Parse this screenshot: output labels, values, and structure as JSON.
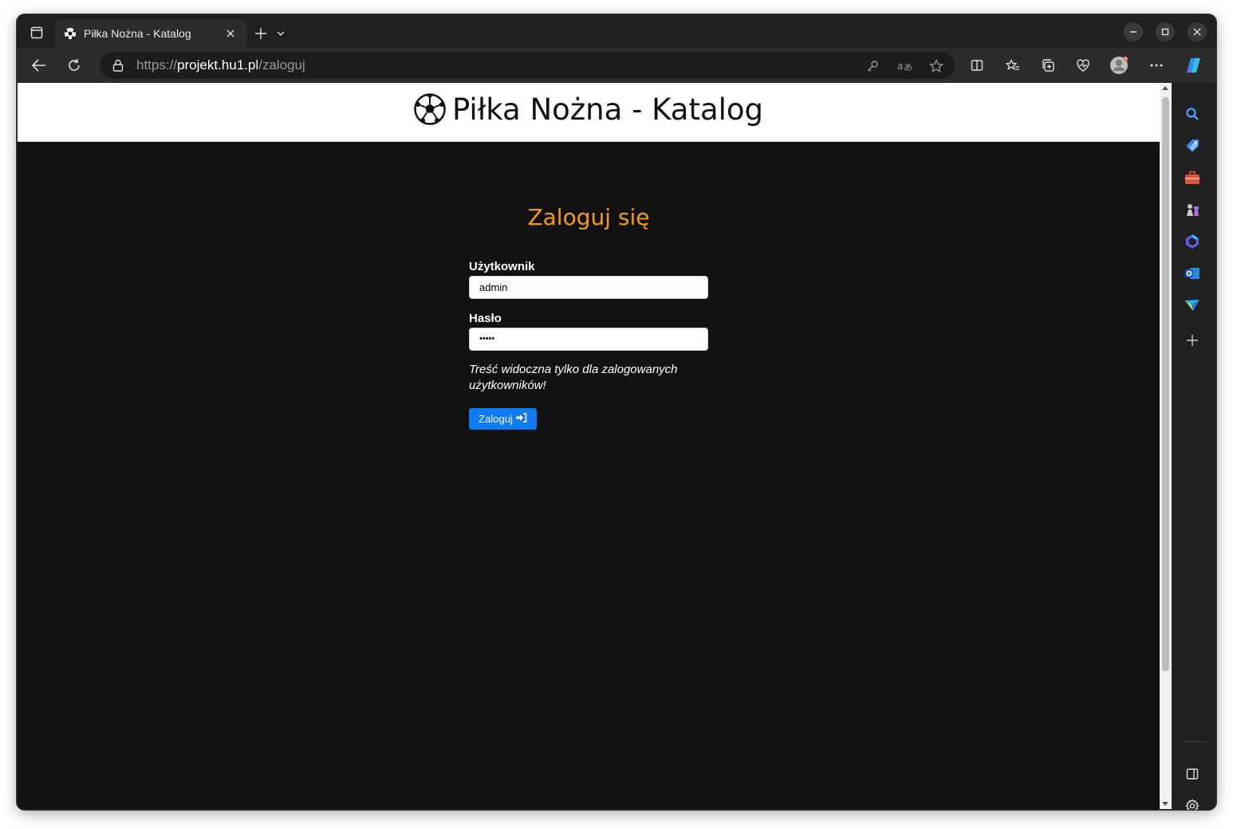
{
  "browser": {
    "tab": {
      "title": "Piłka Nożna - Katalog",
      "favicon": "soccer-ball-icon"
    },
    "address": {
      "scheme": "https://",
      "host": "projekt.hu1.pl",
      "path": "/zaloguj"
    },
    "accent_color": "#0d7bf2"
  },
  "site": {
    "title": "Piłka Nożna - Katalog",
    "logo_icon": "soccer-ball-icon"
  },
  "login": {
    "heading": "Zaloguj się",
    "heading_color": "#f39c12",
    "username_label": "Użytkownik",
    "username_value": "admin",
    "password_label": "Hasło",
    "password_value": "•••••",
    "note": "Treść widoczna tylko dla zalogowanych użytkowników!",
    "submit_label": "Zaloguj",
    "submit_icon": "sign-in-icon"
  }
}
